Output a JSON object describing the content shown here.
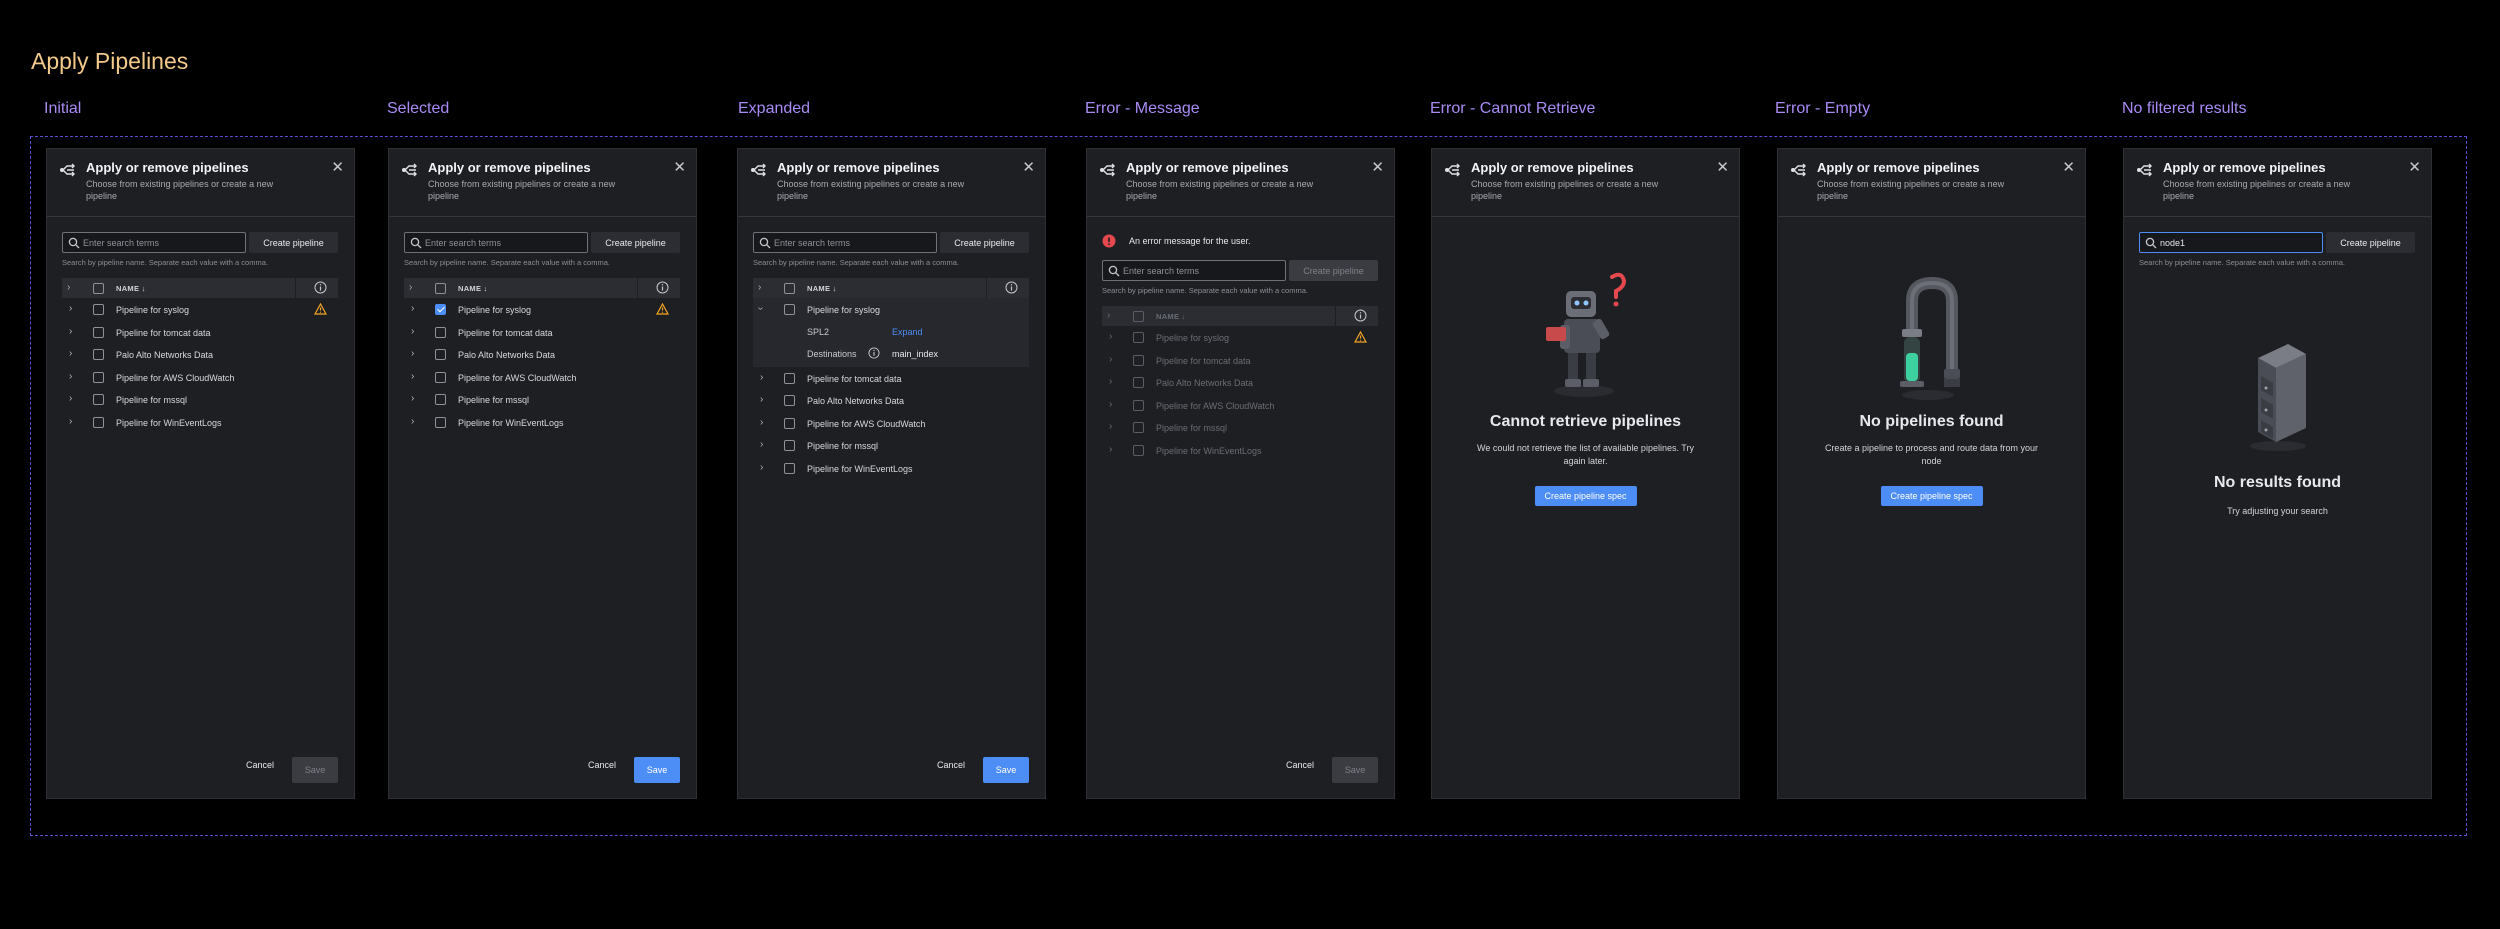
{
  "page": {
    "title": "Apply Pipelines"
  },
  "states": [
    "Initial",
    "Selected",
    "Expanded",
    "Error - Message",
    "Error - Cannot Retrieve",
    "Error - Empty",
    "No filtered results"
  ],
  "dialog": {
    "title": "Apply or remove pipelines",
    "subtitle": "Choose from existing pipelines or create a new pipeline",
    "search_placeholder": "Enter search terms",
    "help": "Search by pipeline name. Separate each value with a comma.",
    "create_label": "Create pipeline",
    "name_header": "NAME",
    "cancel": "Cancel",
    "save": "Save"
  },
  "rows": [
    "Pipeline for syslog",
    "Pipeline for tomcat data",
    "Palo Alto Networks Data",
    "Pipeline for AWS CloudWatch",
    "Pipeline for mssql",
    "Pipeline for WinEventLogs"
  ],
  "expanded": {
    "spl2_label": "SPL2",
    "spl2_value": "Expand",
    "dest_label": "Destinations",
    "dest_value": "main_index"
  },
  "error_message": "An error message for the user.",
  "cannot_retrieve": {
    "title": "Cannot retrieve pipelines",
    "desc": "We could not retrieve the list of available pipelines. Try again later.",
    "button": "Create pipeline spec"
  },
  "empty": {
    "title": "No pipelines found",
    "desc": "Create a pipeline to process and route data from your node",
    "button": "Create pipeline spec"
  },
  "no_results": {
    "search_value": "node1",
    "title": "No results found",
    "desc": "Try adjusting your search"
  },
  "colors": {
    "accent": "#4d8df6",
    "title": "#f2c98a",
    "state_label": "#a98bf4",
    "warning": "#f5a623",
    "error": "#e5484d"
  }
}
